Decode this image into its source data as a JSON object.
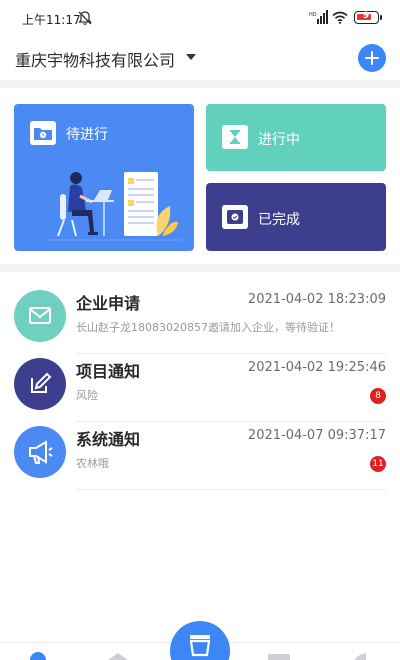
{
  "status_bar": {
    "time": "上午11:17",
    "battery": "9",
    "icons": [
      "mute-icon",
      "signal-icon",
      "wifi-icon",
      "battery-icon"
    ]
  },
  "header": {
    "company": "重庆宇物科技有限公司",
    "icons": [
      "caret-down-icon",
      "add-icon"
    ]
  },
  "cards": {
    "pending": "待进行",
    "in_progress": "进行中",
    "done": "已完成"
  },
  "messages": [
    {
      "title": "企业申请",
      "time": "2021-04-02 18:23:09",
      "preview": "长山赵子龙18083020857邀请加入企业，等待验证！",
      "icon": "mail-icon",
      "color": "#6fd0c0"
    },
    {
      "title": "项目通知",
      "time": "2021-04-02 19:25:46",
      "preview": "风险",
      "badge": "8",
      "icon": "edit-icon",
      "color": "#3e3e8f"
    },
    {
      "title": "系统通知",
      "time": "2021-04-07 09:37:17",
      "preview": "农林哦",
      "badge": "11",
      "icon": "megaphone-icon",
      "color": "#4b8af2"
    }
  ],
  "colors": {
    "accent": "#3d86f5",
    "card_pending": "#4b8af2",
    "card_in_progress": "#61d1bd",
    "card_done": "#3e3e8f",
    "badge": "#e02020"
  }
}
